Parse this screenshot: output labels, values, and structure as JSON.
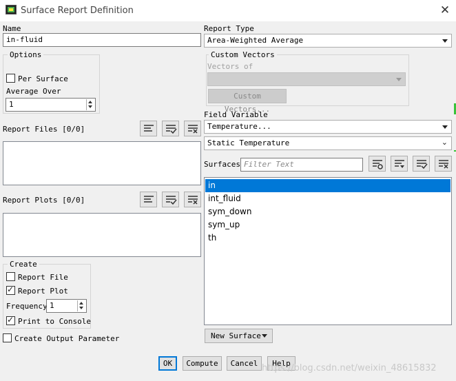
{
  "window": {
    "title": "Surface Report Definition"
  },
  "name": {
    "label": "Name",
    "value": "in-fluid"
  },
  "options": {
    "title": "Options",
    "per_surface_label": "Per Surface",
    "per_surface_checked": false,
    "average_over_label": "Average Over",
    "average_over_value": "1"
  },
  "report_files": {
    "label": "Report Files [0/0]"
  },
  "report_plots": {
    "label": "Report Plots [0/0]"
  },
  "create": {
    "title": "Create",
    "report_file_label": "Report File",
    "report_file_checked": false,
    "report_plot_label": "Report Plot",
    "report_plot_checked": true,
    "frequency_label": "Frequency",
    "frequency_value": "1",
    "print_console_label": "Print to Console",
    "print_console_checked": true
  },
  "create_output_parameter": {
    "label": "Create Output Parameter",
    "checked": false
  },
  "report_type": {
    "label": "Report Type",
    "value": "Area-Weighted Average"
  },
  "custom_vectors": {
    "title": "Custom Vectors",
    "vectors_of_label": "Vectors of",
    "vectors_of_value": "",
    "button_label": "Custom Vectors..."
  },
  "field_variable": {
    "label": "Field Variable",
    "category": "Temperature...",
    "variable": "Static Temperature"
  },
  "surfaces": {
    "label": "Surfaces",
    "filter_placeholder": "Filter Text",
    "items": [
      {
        "label": "in",
        "selected": true
      },
      {
        "label": "int_fluid",
        "selected": false
      },
      {
        "label": "sym_down",
        "selected": false
      },
      {
        "label": "sym_up",
        "selected": false
      },
      {
        "label": "th",
        "selected": false
      }
    ],
    "new_surface_label": "New Surface"
  },
  "buttons": {
    "ok": "OK",
    "compute": "Compute",
    "cancel": "Cancel",
    "help": "Help"
  },
  "watermark": "https://blog.csdn.net/weixin_48615832",
  "colors": {
    "selection": "#0078d7",
    "default_button_border": "#0078d7"
  }
}
